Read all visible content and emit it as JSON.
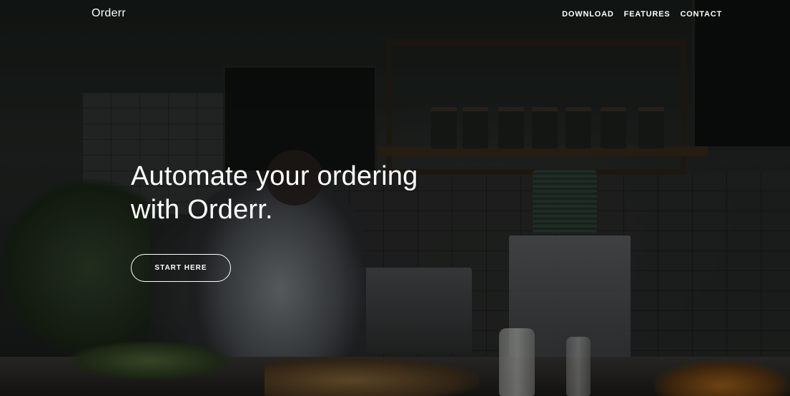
{
  "navbar": {
    "brand": "Orderr",
    "links": [
      "DOWNLOAD",
      "FEATURES",
      "CONTACT"
    ]
  },
  "hero": {
    "headline_line1": "Automate your ordering",
    "headline_line2": "with Orderr.",
    "cta_label": "START HERE"
  },
  "colors": {
    "text": "#ffffff",
    "overlay": "#000000"
  }
}
